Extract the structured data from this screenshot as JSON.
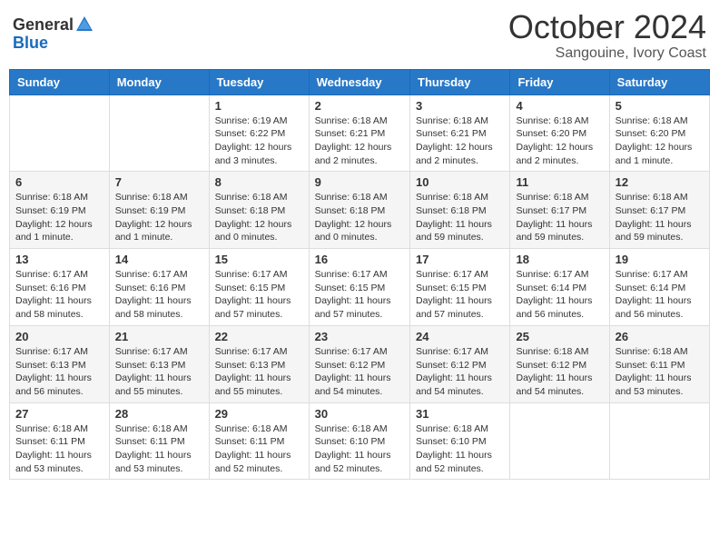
{
  "header": {
    "logo_general": "General",
    "logo_blue": "Blue",
    "month": "October 2024",
    "location": "Sangouine, Ivory Coast"
  },
  "weekdays": [
    "Sunday",
    "Monday",
    "Tuesday",
    "Wednesday",
    "Thursday",
    "Friday",
    "Saturday"
  ],
  "weeks": [
    [
      {
        "day": "",
        "info": ""
      },
      {
        "day": "",
        "info": ""
      },
      {
        "day": "1",
        "info": "Sunrise: 6:19 AM\nSunset: 6:22 PM\nDaylight: 12 hours and 3 minutes."
      },
      {
        "day": "2",
        "info": "Sunrise: 6:18 AM\nSunset: 6:21 PM\nDaylight: 12 hours and 2 minutes."
      },
      {
        "day": "3",
        "info": "Sunrise: 6:18 AM\nSunset: 6:21 PM\nDaylight: 12 hours and 2 minutes."
      },
      {
        "day": "4",
        "info": "Sunrise: 6:18 AM\nSunset: 6:20 PM\nDaylight: 12 hours and 2 minutes."
      },
      {
        "day": "5",
        "info": "Sunrise: 6:18 AM\nSunset: 6:20 PM\nDaylight: 12 hours and 1 minute."
      }
    ],
    [
      {
        "day": "6",
        "info": "Sunrise: 6:18 AM\nSunset: 6:19 PM\nDaylight: 12 hours and 1 minute."
      },
      {
        "day": "7",
        "info": "Sunrise: 6:18 AM\nSunset: 6:19 PM\nDaylight: 12 hours and 1 minute."
      },
      {
        "day": "8",
        "info": "Sunrise: 6:18 AM\nSunset: 6:18 PM\nDaylight: 12 hours and 0 minutes."
      },
      {
        "day": "9",
        "info": "Sunrise: 6:18 AM\nSunset: 6:18 PM\nDaylight: 12 hours and 0 minutes."
      },
      {
        "day": "10",
        "info": "Sunrise: 6:18 AM\nSunset: 6:18 PM\nDaylight: 11 hours and 59 minutes."
      },
      {
        "day": "11",
        "info": "Sunrise: 6:18 AM\nSunset: 6:17 PM\nDaylight: 11 hours and 59 minutes."
      },
      {
        "day": "12",
        "info": "Sunrise: 6:18 AM\nSunset: 6:17 PM\nDaylight: 11 hours and 59 minutes."
      }
    ],
    [
      {
        "day": "13",
        "info": "Sunrise: 6:17 AM\nSunset: 6:16 PM\nDaylight: 11 hours and 58 minutes."
      },
      {
        "day": "14",
        "info": "Sunrise: 6:17 AM\nSunset: 6:16 PM\nDaylight: 11 hours and 58 minutes."
      },
      {
        "day": "15",
        "info": "Sunrise: 6:17 AM\nSunset: 6:15 PM\nDaylight: 11 hours and 57 minutes."
      },
      {
        "day": "16",
        "info": "Sunrise: 6:17 AM\nSunset: 6:15 PM\nDaylight: 11 hours and 57 minutes."
      },
      {
        "day": "17",
        "info": "Sunrise: 6:17 AM\nSunset: 6:15 PM\nDaylight: 11 hours and 57 minutes."
      },
      {
        "day": "18",
        "info": "Sunrise: 6:17 AM\nSunset: 6:14 PM\nDaylight: 11 hours and 56 minutes."
      },
      {
        "day": "19",
        "info": "Sunrise: 6:17 AM\nSunset: 6:14 PM\nDaylight: 11 hours and 56 minutes."
      }
    ],
    [
      {
        "day": "20",
        "info": "Sunrise: 6:17 AM\nSunset: 6:13 PM\nDaylight: 11 hours and 56 minutes."
      },
      {
        "day": "21",
        "info": "Sunrise: 6:17 AM\nSunset: 6:13 PM\nDaylight: 11 hours and 55 minutes."
      },
      {
        "day": "22",
        "info": "Sunrise: 6:17 AM\nSunset: 6:13 PM\nDaylight: 11 hours and 55 minutes."
      },
      {
        "day": "23",
        "info": "Sunrise: 6:17 AM\nSunset: 6:12 PM\nDaylight: 11 hours and 54 minutes."
      },
      {
        "day": "24",
        "info": "Sunrise: 6:17 AM\nSunset: 6:12 PM\nDaylight: 11 hours and 54 minutes."
      },
      {
        "day": "25",
        "info": "Sunrise: 6:18 AM\nSunset: 6:12 PM\nDaylight: 11 hours and 54 minutes."
      },
      {
        "day": "26",
        "info": "Sunrise: 6:18 AM\nSunset: 6:11 PM\nDaylight: 11 hours and 53 minutes."
      }
    ],
    [
      {
        "day": "27",
        "info": "Sunrise: 6:18 AM\nSunset: 6:11 PM\nDaylight: 11 hours and 53 minutes."
      },
      {
        "day": "28",
        "info": "Sunrise: 6:18 AM\nSunset: 6:11 PM\nDaylight: 11 hours and 53 minutes."
      },
      {
        "day": "29",
        "info": "Sunrise: 6:18 AM\nSunset: 6:11 PM\nDaylight: 11 hours and 52 minutes."
      },
      {
        "day": "30",
        "info": "Sunrise: 6:18 AM\nSunset: 6:10 PM\nDaylight: 11 hours and 52 minutes."
      },
      {
        "day": "31",
        "info": "Sunrise: 6:18 AM\nSunset: 6:10 PM\nDaylight: 11 hours and 52 minutes."
      },
      {
        "day": "",
        "info": ""
      },
      {
        "day": "",
        "info": ""
      }
    ]
  ]
}
